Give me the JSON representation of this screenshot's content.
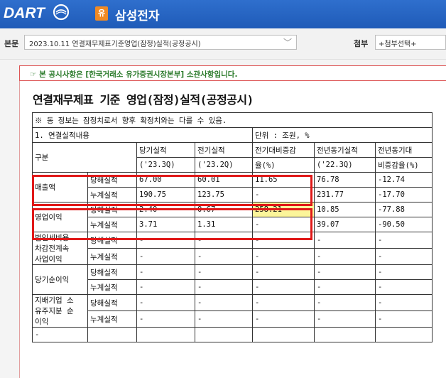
{
  "header": {
    "logo": "DART",
    "company_badge": "유",
    "company_name": "삼성전자"
  },
  "filters": {
    "main_label": "본문",
    "document_value": "2023.10.11   연결재무제표기준영업(잠정)실적(공정공시)",
    "attach_label": "첨부",
    "attach_value": "+첨부선택+"
  },
  "notice": "☞ 본 공시사항은 [한국거래소 유가증권시장본부] 소관사항입니다.",
  "doc_title": "연결재무제표 기준 영업(잠정)실적(공정공시)",
  "table": {
    "note": "※ 동 정보는 잠정치로서 향후 확정치와는 다를 수 있음.",
    "section1": "1. 연결실적내용",
    "unit": "단위 : 조원, %",
    "col_category": "구분",
    "col_current_top": "당기실적",
    "col_current_bottom": "('23.3Q)",
    "col_prev_top": "전기실적",
    "col_prev_bottom": "('23.2Q)",
    "col_qoq_top": "전기대비증감",
    "col_qoq_bottom": "율(%)",
    "col_yoy_prev_top": "전년동기실적",
    "col_yoy_prev_bottom": "('22.3Q)",
    "col_yoy_top": "전년동기대",
    "col_yoy_bottom": "비증감율(%)",
    "rows": [
      {
        "group": "매출액",
        "sub": "당해실적",
        "cur": "67.00",
        "prev": "60.01",
        "qoq": "11.65",
        "ly": "76.78",
        "yoy": "-12.74"
      },
      {
        "group": "",
        "sub": "누계실적",
        "cur": "190.75",
        "prev": "123.75",
        "qoq": "-",
        "ly": "231.77",
        "yoy": "-17.70"
      },
      {
        "group": "영업이익",
        "sub": "당해실적",
        "cur": "2.40",
        "prev": "0.67",
        "qoq": "258.21",
        "ly": "10.85",
        "yoy": "-77.88"
      },
      {
        "group": "",
        "sub": "누계실적",
        "cur": "3.71",
        "prev": "1.31",
        "qoq": "-",
        "ly": "39.07",
        "yoy": "-90.50"
      },
      {
        "group_lines": [
          "법인세비용",
          "차감전계속",
          "사업이익"
        ],
        "sub": "당해실적",
        "cur": "-",
        "prev": "-",
        "qoq": "-",
        "ly": "-",
        "yoy": "-"
      },
      {
        "group": "",
        "sub": "누계실적",
        "cur": "-",
        "prev": "-",
        "qoq": "-",
        "ly": "-",
        "yoy": "-"
      },
      {
        "group": "당기순이익",
        "sub": "당해실적",
        "cur": "-",
        "prev": "-",
        "qoq": "-",
        "ly": "-",
        "yoy": "-"
      },
      {
        "group": "",
        "sub": "누계실적",
        "cur": "-",
        "prev": "-",
        "qoq": "-",
        "ly": "-",
        "yoy": "-"
      },
      {
        "group_lines": [
          "지배기업 소",
          "유주지분 순",
          "이익"
        ],
        "sub": "당해실적",
        "cur": "-",
        "prev": "-",
        "qoq": "-",
        "ly": "-",
        "yoy": "-"
      },
      {
        "group": "",
        "sub": "누계실적",
        "cur": "-",
        "prev": "-",
        "qoq": "-",
        "ly": "-",
        "yoy": "-"
      }
    ],
    "last_row_first": "-"
  }
}
